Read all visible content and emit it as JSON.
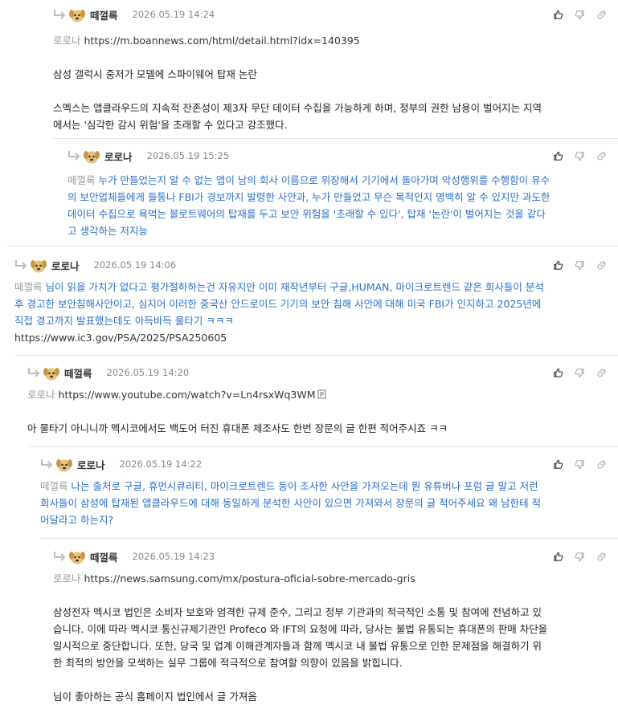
{
  "comments": [
    {
      "nick": "떼껄륵",
      "time": "2026.05.19 14:24",
      "mention": "로로나",
      "lines": [
        {
          "kind": "link",
          "text": "https://m.boannews.com/html/detail.html?idx=140395"
        },
        {
          "kind": "gap"
        },
        {
          "kind": "text",
          "text": "삼성 갤럭시 중저가 모델에 스파이웨어 탑재 논란"
        },
        {
          "kind": "gap"
        },
        {
          "kind": "text",
          "text": "스멕스는 앱클라우드의 지속적 잔존성이 제3자 무단 데이터 수집을 가능하게 하며, 정부의 권한 남용이 벌어지는 지역"
        },
        {
          "kind": "text",
          "text": "에서는 '심각한 감시 위험'을 초래할 수 있다고 강조했다."
        }
      ]
    },
    {
      "nick": "로로나",
      "time": "2026.05.19 15:25",
      "mention": "떼껄륵",
      "lines": [
        {
          "kind": "blue",
          "text": "누가 만들었는지 알 수 없는 앱이 남의 회사 이름으로 위장해서 기기에서 돌아가며 악성행위를 수행함이 유수"
        },
        {
          "kind": "blue",
          "text": "의 보안업체들에게 들통나 FBI가 경보까지 발령한 사안과, 누가 만들었고 무슨 목적인지 명백히 알 수 있지만 과도한"
        },
        {
          "kind": "blue",
          "text": "데이터 수집으로 욕먹는 블로트웨어의 탑재를 두고 보안 위험을 '초래할 수 있다', 탑재 '논란'이 벌어지는 것을 같다"
        },
        {
          "kind": "blue",
          "text": "고 생각하는 저지능"
        }
      ]
    },
    {
      "nick": "로로나",
      "time": "2026.05.19 14:06",
      "mention": "떼껄륵",
      "lines": [
        {
          "kind": "blue",
          "text": "님이 읽을 가치가 없다고 평가절하하는건 자유지만 이미 재작년부터 구글,HUMAN, 마이크로트렌드 같은 회사들이 분석"
        },
        {
          "kind": "blue",
          "text": "후 경고한 보안침해사안이고, 심지어 이러한 중국산 안드로이드 기기의 보안 침해 사안에 대해 미국 FBI가 인지하고 2025년에"
        },
        {
          "kind": "blue",
          "text": "직접 경고까지 발표했는데도 아득바득 물타기 ㅋㅋㅋ"
        },
        {
          "kind": "link",
          "text": "https://www.ic3.gov/PSA/2025/PSA250605"
        }
      ]
    },
    {
      "nick": "떼껄륵",
      "time": "2026.05.19 14:20",
      "mention": "로로나",
      "lines": [
        {
          "kind": "link",
          "text": "https://www.youtube.com/watch?v=Ln4rsxWq3WM",
          "ext": true
        },
        {
          "kind": "gap"
        },
        {
          "kind": "text",
          "text": "아 물타기 아니니까 멕시코에서도 백도어 터진 휴대폰 제조사도 한번 장문의 글 한편 적어주시죠 ㅋㅋ"
        }
      ]
    },
    {
      "nick": "로로나",
      "time": "2026.05.19 14:22",
      "mention": "떼껄륵",
      "lines": [
        {
          "kind": "blue",
          "text": "나는 출처로 구글, 휴먼시큐리티, 마이크로트렌드 등이 조사한 사안을 가져오는데 뭔 유튜버나 포럼 글 말고 저런"
        },
        {
          "kind": "blue",
          "text": "회사들이 삼성에 탑재된 앱클라우드에 대해 동일하게 분석한 사안이 있으면 가져와서 장문의 글 적어주세요 왜 남한테 적"
        },
        {
          "kind": "blue",
          "text": "어달라고 하는지?"
        }
      ]
    },
    {
      "nick": "떼껄륵",
      "time": "2026.05.19 14:23",
      "mention": "로로나",
      "lines": [
        {
          "kind": "link",
          "text": "https://news.samsung.com/mx/postura-oficial-sobre-mercado-gris"
        },
        {
          "kind": "gap"
        },
        {
          "kind": "text",
          "text": "삼성전자 멕시코 법인은 소비자 보호와 엄격한 규제 준수, 그리고 정부 기관과의 적극적인 소통 및 참여에 전념하고 있"
        },
        {
          "kind": "text",
          "text": "습니다. 이에 따라 멕시코 통신규제기관인 Profeco 와 IFT의 요청에 따라, 당사는 불법 유통되는 휴대폰의 판매 차단을"
        },
        {
          "kind": "text",
          "text": "일시적으로 중단합니다. 또한, 당국 및 업계 이해관계자들과 함께 멕시코 내 불법 유통으로 인한 문제점을 해결하기 위"
        },
        {
          "kind": "text",
          "text": "한 최적의 방안을 모색하는 실무 그룹에 적극적으로 참여할 의향이 있음을 밝힙니다."
        },
        {
          "kind": "gap"
        },
        {
          "kind": "text",
          "text": "님이 좋아하는 공식 홈페이지 법인에서 글 가져옴"
        }
      ]
    }
  ]
}
